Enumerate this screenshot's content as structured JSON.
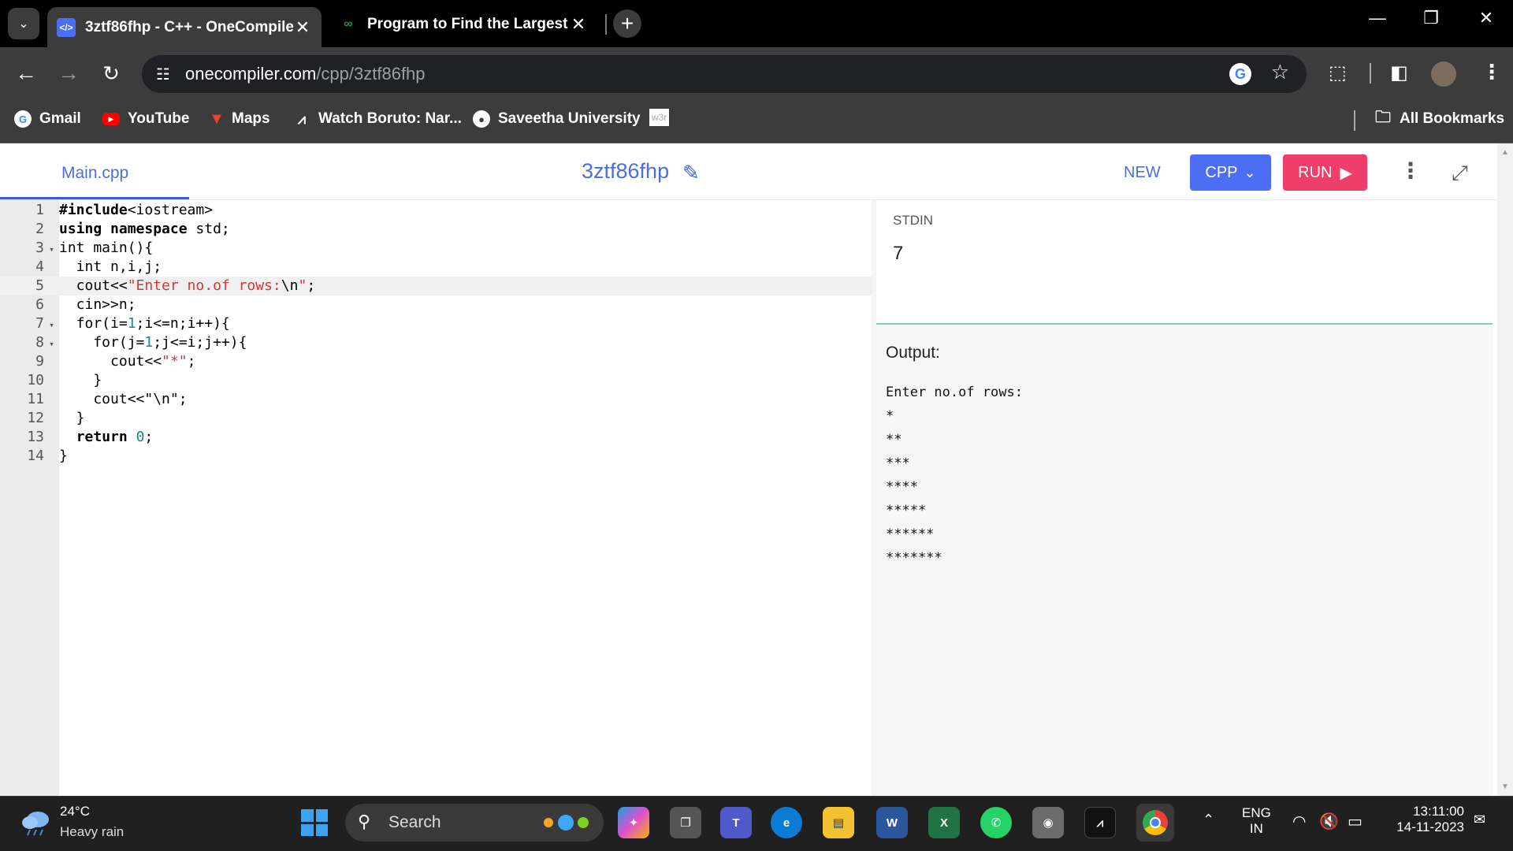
{
  "browser": {
    "tabs": [
      {
        "title": "3ztf86fhp - C++ - OneCompiler",
        "favicon": "code-icon"
      },
      {
        "title": "Program to Find the Largest Number",
        "favicon": "gfg-icon"
      }
    ],
    "url_host": "onecompiler.com",
    "url_path": "/cpp/3ztf86fhp",
    "bookmarks": [
      "Gmail",
      "YouTube",
      "Maps",
      "Watch Boruto: Nar...",
      "Saveetha University",
      "w3r"
    ],
    "all_bookmarks": "All Bookmarks"
  },
  "app": {
    "file_tab": "Main.cpp",
    "project_name": "3ztf86fhp",
    "new_label": "NEW",
    "lang_label": "CPP",
    "run_label": "RUN",
    "accent": "#4c6ef5",
    "run_color": "#f03e6a"
  },
  "editor": {
    "line_numbers": [
      "1",
      "2",
      "3",
      "4",
      "5",
      "6",
      "7",
      "8",
      "9",
      "10",
      "11",
      "12",
      "13",
      "14"
    ],
    "highlighted_line": "5"
  },
  "stdin": {
    "label": "STDIN",
    "value": "7"
  },
  "output": {
    "label": "Output:",
    "lines": [
      "Enter no.of rows:",
      "*",
      "**",
      "***",
      "****",
      "*****",
      "******",
      "*******"
    ]
  },
  "taskbar": {
    "temp": "24°C",
    "weather": "Heavy rain",
    "search": "Search",
    "lang1": "ENG",
    "lang2": "IN",
    "time": "13:11:00",
    "date": "14-11-2023"
  }
}
